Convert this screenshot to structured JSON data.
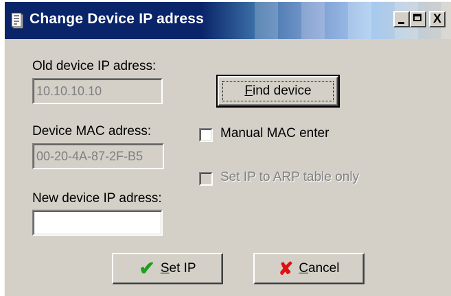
{
  "window": {
    "title": "Change Device IP adress",
    "title_icon": "device-icon",
    "controls": {
      "minimize": "minimize-icon",
      "maximize": "maximize-icon",
      "close_glyph": "X"
    }
  },
  "old_ip": {
    "label": "Old  device IP adress:",
    "value": "10.10.10.10"
  },
  "find_button": {
    "label_first": "F",
    "label_rest": "ind device"
  },
  "mac": {
    "label": "Device MAC adress:",
    "value": "00-20-4A-87-2F-B5"
  },
  "manual_mac": {
    "label": "Manual MAC enter",
    "checked": false
  },
  "arp_only": {
    "label": "Set IP to ARP table only",
    "checked": false,
    "enabled": false
  },
  "new_ip": {
    "label": "New device IP adress:",
    "value": ""
  },
  "set_ip_button": {
    "icon": "checkmark-icon",
    "label_first": "S",
    "label_rest": "et IP"
  },
  "cancel_button": {
    "icon": "cancel-x-icon",
    "label_first": "C",
    "label_rest": "ancel"
  },
  "colors": {
    "title_bar": "#0a246a",
    "dialog_bg": "#d4d0c8",
    "checkmark": "#1f9e1f",
    "cancel_x": "#e01010"
  }
}
